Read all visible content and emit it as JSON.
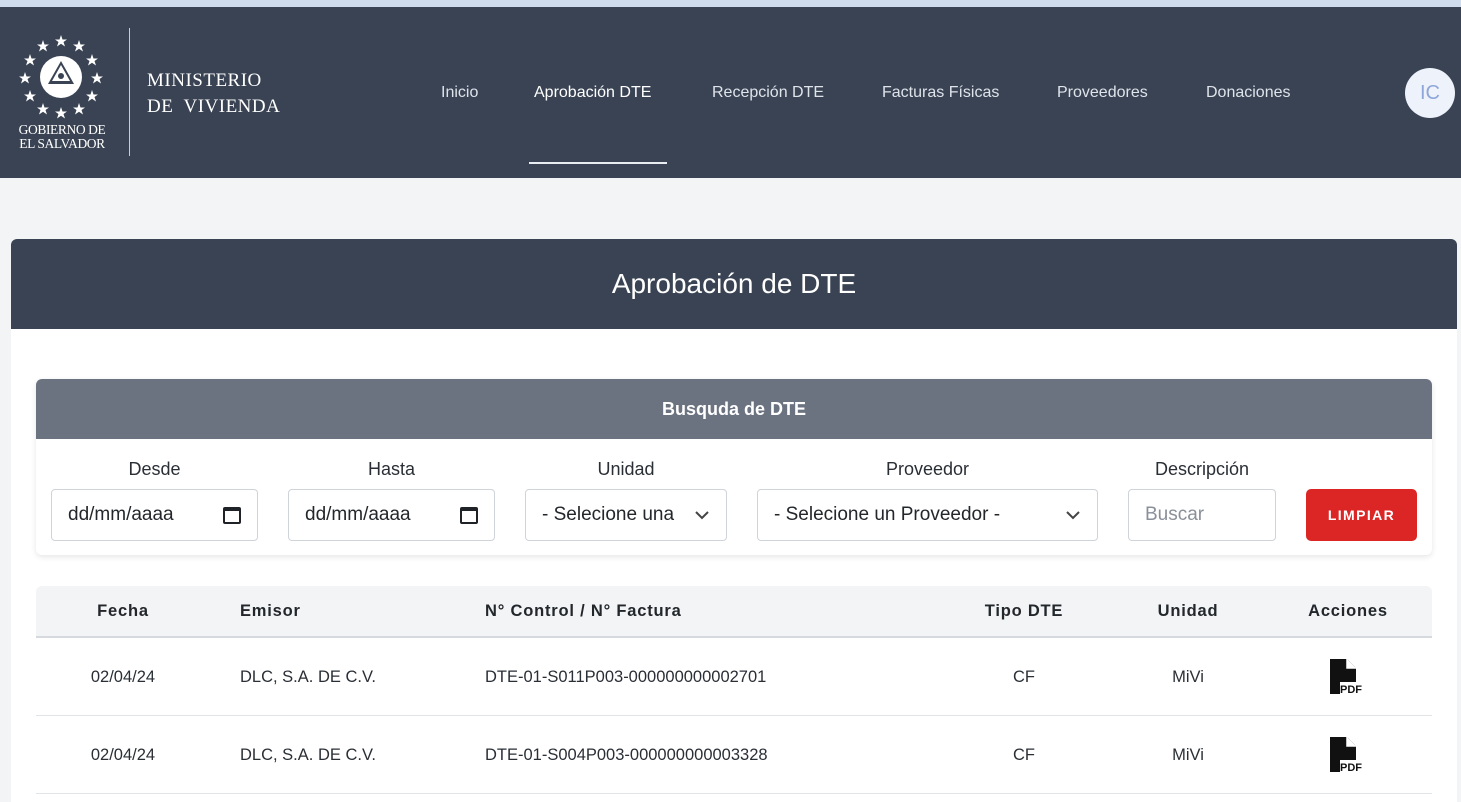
{
  "brand": {
    "caption_line1": "GOBIERNO DE",
    "caption_line2": "EL SALVADOR",
    "ministry_line1": "MINISTERIO",
    "ministry_line2": "DE  VIVIENDA"
  },
  "nav": {
    "items": [
      {
        "label": "Inicio"
      },
      {
        "label": "Aprobación DTE"
      },
      {
        "label": "Recepción DTE"
      },
      {
        "label": "Facturas Físicas"
      },
      {
        "label": "Proveedores"
      },
      {
        "label": "Donaciones"
      }
    ],
    "active": "Aprobación DTE"
  },
  "user": {
    "initials": "IC"
  },
  "page": {
    "title": "Aprobación de DTE"
  },
  "search": {
    "title": "Busquda de DTE",
    "desde_label": "Desde",
    "desde_value": "dd/mm/aaaa",
    "hasta_label": "Hasta",
    "hasta_value": "dd/mm/aaaa",
    "unidad_label": "Unidad",
    "unidad_value": "- Selecione una",
    "proveedor_label": "Proveedor",
    "proveedor_value": "- Selecione un Proveedor -",
    "descripcion_label": "Descripción",
    "descripcion_placeholder": "Buscar",
    "clear_label": "LIMPIAR"
  },
  "table": {
    "columns": [
      "Fecha",
      "Emisor",
      "N° Control / N° Factura",
      "Tipo DTE",
      "Unidad",
      "Acciones"
    ],
    "rows": [
      {
        "fecha": "02/04/24",
        "emisor": "DLC, S.A. DE C.V.",
        "control": "DTE-01-S011P003-000000000002701",
        "tipo": "CF",
        "unidad": "MiVi",
        "action_icon": "pdf-icon"
      },
      {
        "fecha": "02/04/24",
        "emisor": "DLC, S.A. DE C.V.",
        "control": "DTE-01-S004P003-000000000003328",
        "tipo": "CF",
        "unidad": "MiVi",
        "action_icon": "pdf-icon"
      }
    ]
  },
  "colors": {
    "navbar": "#394353",
    "search_header": "#6b7280",
    "clear_button": "#dc2626",
    "page_bg": "#f2f4f5"
  }
}
